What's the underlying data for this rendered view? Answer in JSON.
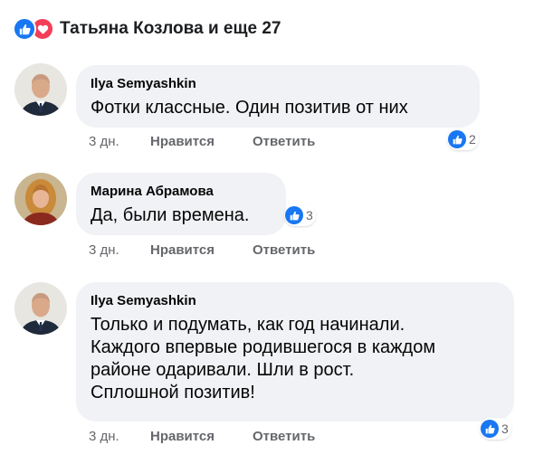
{
  "reactions_summary": {
    "text": "Татьяна Козлова и еще 27",
    "icons": [
      "like-icon",
      "love-icon"
    ],
    "colors": {
      "like": "#1877f2",
      "love": "#f33e58"
    }
  },
  "comments": [
    {
      "author": "Ilya Semyashkin",
      "text": "Фотки классные. Один позитив от них",
      "time": "3 дн.",
      "like_label": "Нравится",
      "reply_label": "Ответить",
      "reaction_count": "2"
    },
    {
      "author": "Марина Абрамова",
      "text": "Да, были времена.",
      "time": "3 дн.",
      "like_label": "Нравится",
      "reply_label": "Ответить",
      "reaction_count": "3"
    },
    {
      "author": "Ilya Semyashkin",
      "text": "Только и подумать, как год начинали.\nКаждого впервые родившегося в каждом\nрайоне одаривали. Шли в рост.\nСплошной позитив!",
      "lines": [
        "Только и подумать, как год начинали.",
        "Каждого впервые родившегося в каждом",
        "районе одаривали. Шли в рост.",
        "Сплошной позитив!"
      ],
      "time": "3 дн.",
      "like_label": "Нравится",
      "reply_label": "Ответить",
      "reaction_count": "3"
    }
  ]
}
